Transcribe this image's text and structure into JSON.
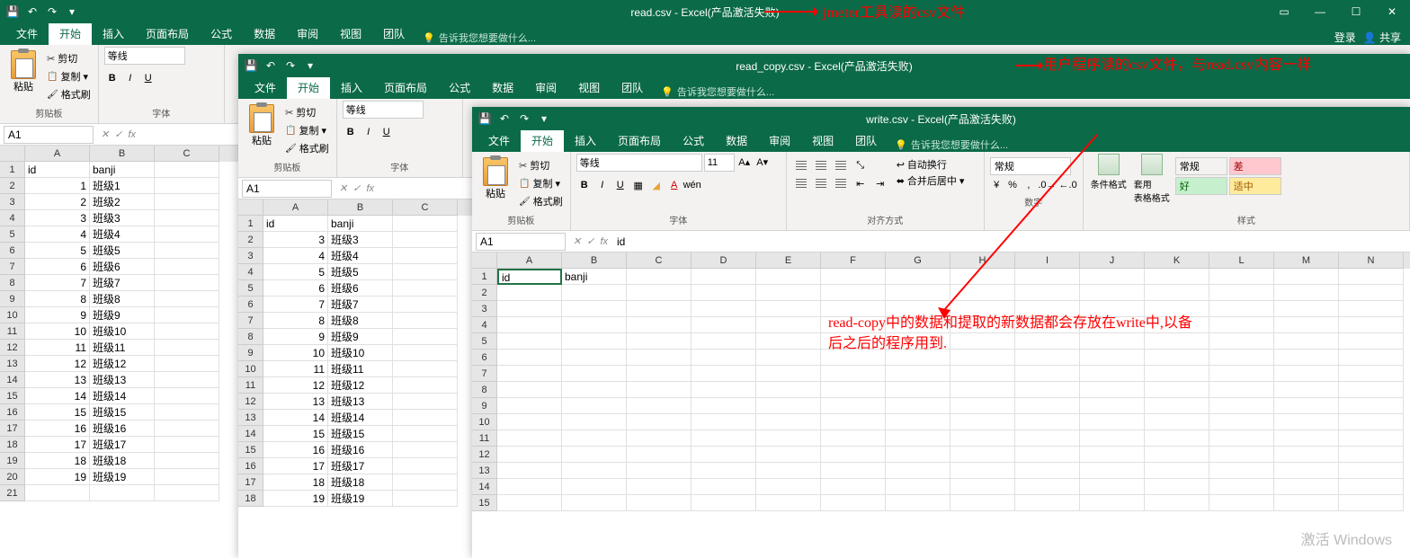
{
  "windows": {
    "w1": {
      "title": "read.csv - Excel(产品激活失败)"
    },
    "w2": {
      "title": "read_copy.csv - Excel(产品激活失败)"
    },
    "w3": {
      "title": "write.csv - Excel(产品激活失败)"
    }
  },
  "tabs": {
    "file": "文件",
    "home": "开始",
    "insert": "插入",
    "layout": "页面布局",
    "formula": "公式",
    "data": "数据",
    "review": "审阅",
    "view": "视图",
    "team": "团队",
    "tell": "告诉我您想要做什么...",
    "login": "登录",
    "share": "共享"
  },
  "ribbon": {
    "paste": "粘贴",
    "cut": "剪切",
    "copy": "复制",
    "format_painter": "格式刷",
    "clipboard": "剪贴板",
    "font_group": "字体",
    "font_name": "等线",
    "font_size": "11",
    "align_group": "对齐方式",
    "wrap": "自动换行",
    "merge": "合并后居中",
    "number_group": "数字",
    "number_format": "常规",
    "cond_format": "条件格式",
    "table_format": "套用\n表格格式",
    "styles_group": "样式",
    "style_normal": "常规",
    "style_bad": "差",
    "style_good": "好",
    "style_neutral": "适中"
  },
  "namebox": "A1",
  "formula": {
    "w3_value": "id"
  },
  "headers": {
    "id": "id",
    "banji": "banji"
  },
  "cols": [
    "A",
    "B",
    "C",
    "D",
    "E",
    "F",
    "G",
    "H",
    "I",
    "J",
    "K",
    "L",
    "M",
    "N"
  ],
  "w1_data": [
    [
      "id",
      "banji"
    ],
    [
      1,
      "班级1"
    ],
    [
      2,
      "班级2"
    ],
    [
      3,
      "班级3"
    ],
    [
      4,
      "班级4"
    ],
    [
      5,
      "班级5"
    ],
    [
      6,
      "班级6"
    ],
    [
      7,
      "班级7"
    ],
    [
      8,
      "班级8"
    ],
    [
      9,
      "班级9"
    ],
    [
      10,
      "班级10"
    ],
    [
      11,
      "班级11"
    ],
    [
      12,
      "班级12"
    ],
    [
      13,
      "班级13"
    ],
    [
      14,
      "班级14"
    ],
    [
      15,
      "班级15"
    ],
    [
      16,
      "班级16"
    ],
    [
      17,
      "班级17"
    ],
    [
      18,
      "班级18"
    ],
    [
      19,
      "班级19"
    ]
  ],
  "w2_data": [
    [
      "id",
      "banji"
    ],
    [
      3,
      "班级3"
    ],
    [
      4,
      "班级4"
    ],
    [
      5,
      "班级5"
    ],
    [
      6,
      "班级6"
    ],
    [
      7,
      "班级7"
    ],
    [
      8,
      "班级8"
    ],
    [
      9,
      "班级9"
    ],
    [
      10,
      "班级10"
    ],
    [
      11,
      "班级11"
    ],
    [
      12,
      "班级12"
    ],
    [
      13,
      "班级13"
    ],
    [
      14,
      "班级14"
    ],
    [
      15,
      "班级15"
    ],
    [
      16,
      "班级16"
    ],
    [
      17,
      "班级17"
    ],
    [
      18,
      "班级18"
    ],
    [
      19,
      "班级19"
    ]
  ],
  "w3_data": [
    [
      "id",
      "banji"
    ]
  ],
  "annotations": {
    "a1": "jmeter工具读的csv文件",
    "a2": "用户程序读的csv文件，与read.csv内容一样",
    "a3_line1": "read-copy中的数据和提取的新数据都会存放在write中,以备",
    "a3_line2": "后之后的程序用到."
  },
  "watermark": "激活 Windows"
}
